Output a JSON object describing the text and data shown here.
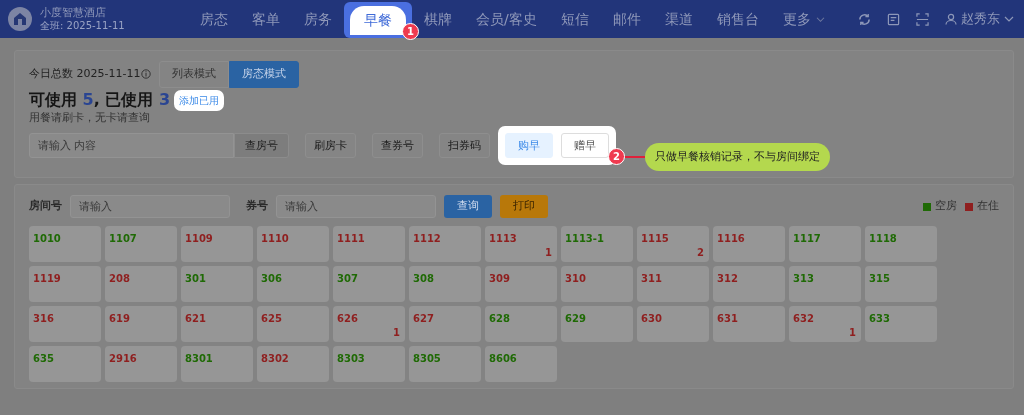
{
  "header": {
    "hotel_name": "小度智慧酒店",
    "shift": "全班: 2025-11-11",
    "user": "赵秀东",
    "nav": [
      {
        "label": "房态",
        "selected": false,
        "kind": "link"
      },
      {
        "label": "客单",
        "selected": false,
        "kind": "link"
      },
      {
        "label": "房务",
        "selected": false,
        "kind": "link"
      },
      {
        "label": "早餐",
        "selected": true,
        "kind": "link"
      },
      {
        "label": "棋牌",
        "selected": false,
        "kind": "link"
      },
      {
        "label": "会员/客史",
        "selected": false,
        "kind": "link"
      },
      {
        "label": "短信",
        "selected": false,
        "kind": "link"
      },
      {
        "label": "邮件",
        "selected": false,
        "kind": "link"
      },
      {
        "label": "渠道",
        "selected": false,
        "kind": "link"
      },
      {
        "label": "销售台",
        "selected": false,
        "kind": "link"
      },
      {
        "label": "更多",
        "selected": false,
        "kind": "dropdown"
      }
    ]
  },
  "summary": {
    "title": "今日总数 2025-11-11",
    "view_modes": [
      {
        "label": "列表模式",
        "selected": false
      },
      {
        "label": "房态模式",
        "selected": true
      }
    ],
    "available_label": "可使用",
    "available": "5",
    "used_label": ", 已使用",
    "used": "3",
    "add_used_link": "添加已用",
    "hint": "用餐请刷卡，无卡请查询",
    "search": {
      "placeholder": "请输入 内容",
      "button": "查房号"
    },
    "actions": [
      "刷房卡",
      "查券号",
      "扫券码"
    ],
    "highlighted_actions": [
      {
        "label": "购早",
        "selected": true
      },
      {
        "label": "赠早",
        "selected": false
      }
    ]
  },
  "tour": [
    {
      "number": "1"
    },
    {
      "number": "2",
      "text": "只做早餐核销记录，不与房间绑定"
    }
  ],
  "filter": {
    "room_label": "房间号",
    "room_placeholder": "请输入",
    "voucher_label": "券号",
    "voucher_placeholder": "请输入",
    "query_button": "查询",
    "print_button": "打印"
  },
  "legend": [
    {
      "label": "空房",
      "color": "#1f6a05"
    },
    {
      "label": "在住",
      "color": "#8f1f1f"
    }
  ],
  "rooms": [
    {
      "number": "1010",
      "color": "#1f6a05"
    },
    {
      "number": "1107",
      "color": "#1f6a05"
    },
    {
      "number": "1109",
      "color": "#8f1f1f"
    },
    {
      "number": "1110",
      "color": "#8f1f1f"
    },
    {
      "number": "1111",
      "color": "#8f1f1f"
    },
    {
      "number": "1112",
      "color": "#8f1f1f"
    },
    {
      "number": "1113",
      "color": "#8f1f1f",
      "count": "1"
    },
    {
      "number": "1113-1",
      "color": "#1f6a05"
    },
    {
      "number": "1115",
      "color": "#8f1f1f",
      "count": "2"
    },
    {
      "number": "1116",
      "color": "#8f1f1f"
    },
    {
      "number": "1117",
      "color": "#1f6a05"
    },
    {
      "number": "1118",
      "color": "#1f6a05"
    },
    {
      "number": "1119",
      "color": "#8f1f1f"
    },
    {
      "number": "208",
      "color": "#8f1f1f"
    },
    {
      "number": "301",
      "color": "#1f6a05"
    },
    {
      "number": "306",
      "color": "#1f6a05"
    },
    {
      "number": "307",
      "color": "#1f6a05"
    },
    {
      "number": "308",
      "color": "#1f6a05"
    },
    {
      "number": "309",
      "color": "#8f1f1f"
    },
    {
      "number": "310",
      "color": "#8f1f1f"
    },
    {
      "number": "311",
      "color": "#8f1f1f"
    },
    {
      "number": "312",
      "color": "#8f1f1f"
    },
    {
      "number": "313",
      "color": "#1f6a05"
    },
    {
      "number": "315",
      "color": "#1f6a05"
    },
    {
      "number": "316",
      "color": "#8f1f1f"
    },
    {
      "number": "619",
      "color": "#8f1f1f"
    },
    {
      "number": "621",
      "color": "#8f1f1f"
    },
    {
      "number": "625",
      "color": "#8f1f1f"
    },
    {
      "number": "626",
      "color": "#8f1f1f",
      "count": "1"
    },
    {
      "number": "627",
      "color": "#8f1f1f"
    },
    {
      "number": "628",
      "color": "#1f6a05"
    },
    {
      "number": "629",
      "color": "#1f6a05"
    },
    {
      "number": "630",
      "color": "#8f1f1f"
    },
    {
      "number": "631",
      "color": "#8f1f1f"
    },
    {
      "number": "632",
      "color": "#8f1f1f",
      "count": "1"
    },
    {
      "number": "633",
      "color": "#1f6a05"
    },
    {
      "number": "635",
      "color": "#1f6a05"
    },
    {
      "number": "2916",
      "color": "#8f1f1f"
    },
    {
      "number": "8301",
      "color": "#1f6a05"
    },
    {
      "number": "8302",
      "color": "#8f1f1f"
    },
    {
      "number": "8303",
      "color": "#1f6a05"
    },
    {
      "number": "8305",
      "color": "#1f6a05"
    },
    {
      "number": "8606",
      "color": "#1f6a05"
    }
  ]
}
